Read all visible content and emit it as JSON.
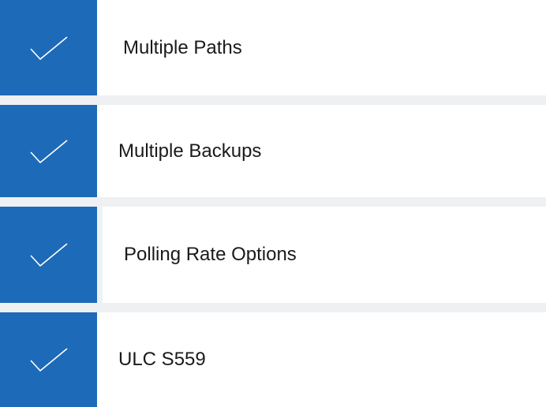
{
  "theme": {
    "accent": "#1d6ab8",
    "separator": "#eef0f2",
    "text": "#1a1a1a"
  },
  "features": [
    {
      "label": "Multiple Paths",
      "icon": "checkmark-icon"
    },
    {
      "label": "Multiple Backups",
      "icon": "checkmark-icon"
    },
    {
      "label": "Polling Rate Options",
      "icon": "checkmark-icon"
    },
    {
      "label": "ULC S559",
      "icon": "checkmark-icon"
    }
  ]
}
